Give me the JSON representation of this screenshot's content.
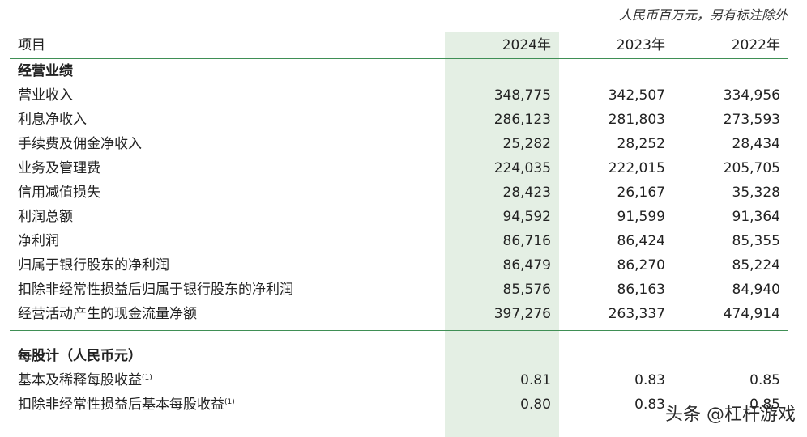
{
  "unit_note": "人民币百万元，另有标注除外",
  "header": {
    "item": "项目",
    "years": [
      "2024年",
      "2023年",
      "2022年"
    ]
  },
  "sections": [
    {
      "title": "经营业绩",
      "rows": [
        {
          "label": "营业收入",
          "values": [
            "348,775",
            "342,507",
            "334,956"
          ]
        },
        {
          "label": "利息净收入",
          "values": [
            "286,123",
            "281,803",
            "273,593"
          ]
        },
        {
          "label": "手续费及佣金净收入",
          "values": [
            "25,282",
            "28,252",
            "28,434"
          ]
        },
        {
          "label": "业务及管理费",
          "values": [
            "224,035",
            "222,015",
            "205,705"
          ]
        },
        {
          "label": "信用减值损失",
          "values": [
            "28,423",
            "26,167",
            "35,328"
          ]
        },
        {
          "label": "利润总额",
          "values": [
            "94,592",
            "91,599",
            "91,364"
          ]
        },
        {
          "label": "净利润",
          "values": [
            "86,716",
            "86,424",
            "85,355"
          ]
        },
        {
          "label": "归属于银行股东的净利润",
          "values": [
            "86,479",
            "86,270",
            "85,224"
          ]
        },
        {
          "label": "扣除非经常性损益后归属于银行股东的净利润",
          "values": [
            "85,576",
            "86,163",
            "84,940"
          ]
        },
        {
          "label": "经营活动产生的现金流量净额",
          "values": [
            "397,276",
            "263,337",
            "474,914"
          ]
        }
      ]
    },
    {
      "title": "每股计（人民币元）",
      "rows": [
        {
          "label": "基本及稀释每股收益",
          "note": "(1)",
          "values": [
            "0.81",
            "0.83",
            "0.85"
          ]
        },
        {
          "label": "扣除非经常性损益后基本每股收益",
          "note": "(1)",
          "values": [
            "0.80",
            "0.83",
            "0.85"
          ]
        }
      ]
    }
  ],
  "watermark": "头条 @杠杆游戏"
}
